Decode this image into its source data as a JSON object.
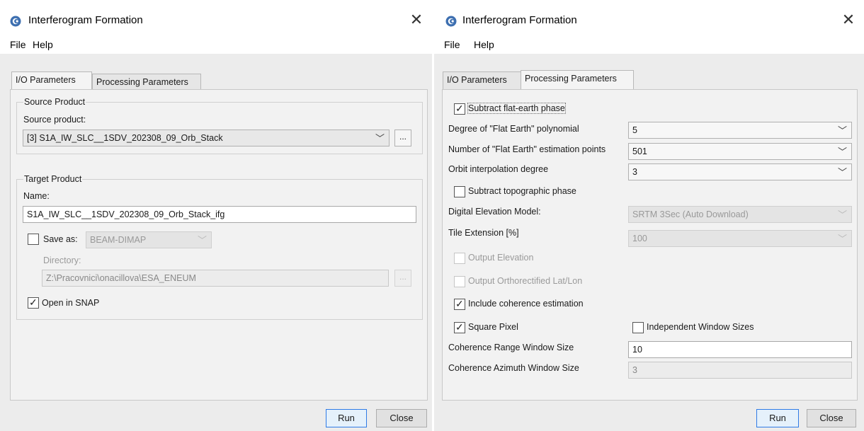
{
  "left_window": {
    "title": "Interferogram Formation",
    "menu": {
      "file": "File",
      "help": "Help"
    },
    "tabs": {
      "io": "I/O Parameters",
      "processing": "Processing Parameters"
    },
    "source_product": {
      "group_label": "Source Product",
      "field_label": "Source product:",
      "selected": "[3] S1A_IW_SLC__1SDV_202308_09_Orb_Stack",
      "browse": "..."
    },
    "target_product": {
      "group_label": "Target Product",
      "name_label": "Name:",
      "name_value": "S1A_IW_SLC__1SDV_202308_09_Orb_Stack_ifg",
      "save_as_label": "Save as:",
      "save_as_checked": false,
      "format": "BEAM-DIMAP",
      "directory_label": "Directory:",
      "directory_value": "Z:\\Pracovnici\\onacillova\\ESA_ENEUM",
      "browse": "...",
      "open_in_snap_label": "Open in SNAP",
      "open_in_snap_checked": true
    },
    "buttons": {
      "run": "Run",
      "close": "Close"
    }
  },
  "right_window": {
    "title": "Interferogram Formation",
    "menu": {
      "file": "File",
      "help": "Help"
    },
    "tabs": {
      "io": "I/O Parameters",
      "processing": "Processing Parameters"
    },
    "params": {
      "subtract_flat_earth_label": "Subtract flat-earth phase",
      "subtract_flat_earth_checked": true,
      "degree_label": "Degree of \"Flat Earth\" polynomial",
      "degree_value": "5",
      "num_points_label": "Number of \"Flat Earth\" estimation points",
      "num_points_value": "501",
      "orbit_degree_label": "Orbit interpolation degree",
      "orbit_degree_value": "3",
      "subtract_topo_label": "Subtract topographic phase",
      "subtract_topo_checked": false,
      "dem_label": "Digital Elevation Model:",
      "dem_value": "SRTM 3Sec (Auto Download)",
      "tile_ext_label": "Tile Extension [%]",
      "tile_ext_value": "100",
      "output_elevation_label": "Output Elevation",
      "output_ortho_label": "Output Orthorectified Lat/Lon",
      "include_coherence_label": "Include coherence estimation",
      "include_coherence_checked": true,
      "square_pixel_label": "Square Pixel",
      "square_pixel_checked": true,
      "independent_window_label": "Independent Window Sizes",
      "independent_window_checked": false,
      "coh_range_label": "Coherence Range Window Size",
      "coh_range_value": "10",
      "coh_azimuth_label": "Coherence Azimuth Window Size",
      "coh_azimuth_value": "3"
    },
    "buttons": {
      "run": "Run",
      "close": "Close"
    }
  },
  "icons": {
    "app_logo": "snap-logo-icon",
    "close": "close-icon",
    "dropdown": "chevron-down-icon",
    "check": "checkmark-icon"
  },
  "colors": {
    "accent": "#2f7be6",
    "window_bg": "#ececec",
    "panel_bg": "#f2f2f2"
  }
}
